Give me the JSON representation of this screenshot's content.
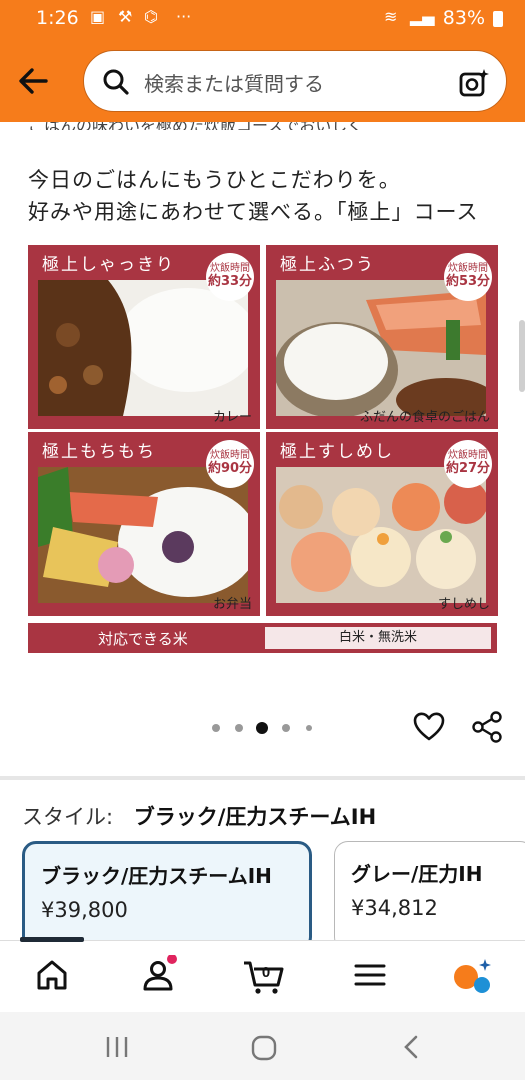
{
  "status_bar": {
    "time": "1:26",
    "battery": "83%"
  },
  "search": {
    "placeholder": "検索または質問する"
  },
  "hero": {
    "clipped_text": "ごはんの味わいを極めた炊飯コースでおいしく",
    "headline_line1": "今日のごはんにもうひとこだわりを。",
    "headline_line2": "好みや用途にあわせて選べる。「極上」コース",
    "tiles": [
      {
        "name": "極上しゃっきり",
        "badge_label": "炊飯時間",
        "badge_time": "約33分",
        "caption": "カレー"
      },
      {
        "name": "極上ふつう",
        "badge_label": "炊飯時間",
        "badge_time": "約53分",
        "caption": "ふだんの食卓のごはん"
      },
      {
        "name": "極上もちもち",
        "badge_label": "炊飯時間",
        "badge_time": "約90分",
        "caption": "お弁当"
      },
      {
        "name": "極上すしめし",
        "badge_label": "炊飯時間",
        "badge_time": "約27分",
        "caption": "すしめし"
      }
    ],
    "rice_label": "対応できる米",
    "rice_value": "白米・無洗米"
  },
  "carousel": {
    "count": 5,
    "active_index": 2
  },
  "style": {
    "label": "スタイル:",
    "selected": "ブラック/圧力スチームIH",
    "options": [
      {
        "name": "ブラック/圧力スチームIH",
        "price": "¥39,800"
      },
      {
        "name": "グレー/圧力IH",
        "price": "¥34,812"
      }
    ]
  },
  "nav": {
    "cart_count": "0"
  },
  "colors": {
    "brand_orange": "#f67c1b",
    "tile_red": "#a93542",
    "selected_border": "#2a5b84"
  }
}
